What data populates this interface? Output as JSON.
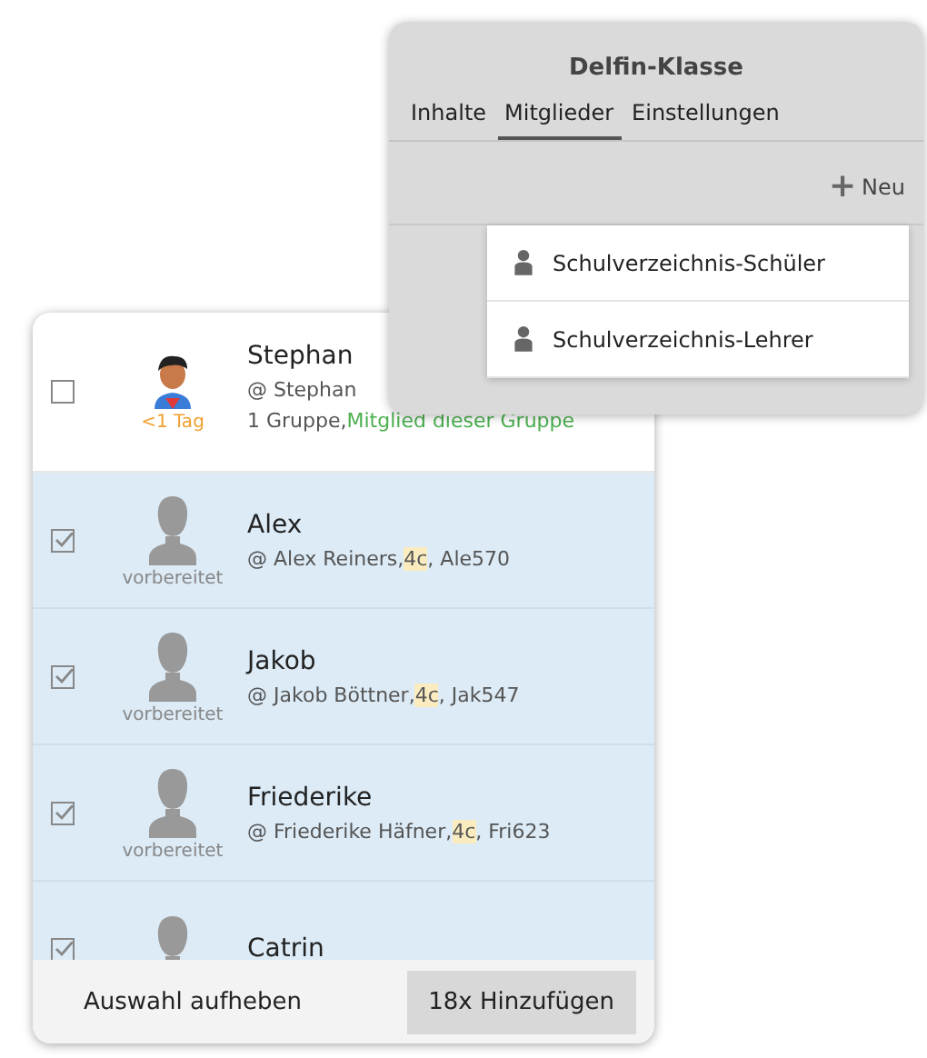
{
  "dialog": {
    "title": "Delfin-Klasse",
    "tabs": [
      {
        "label": "Inhalte",
        "selected": false
      },
      {
        "label": "Mitglieder",
        "selected": true
      },
      {
        "label": "Einstellungen",
        "selected": false
      }
    ],
    "new_button": {
      "icon": "+",
      "label": "Neu"
    },
    "menu": [
      {
        "label": "Schulverzeichnis-Schüler"
      },
      {
        "label": "Schulverzeichnis-Lehrer"
      }
    ]
  },
  "members": [
    {
      "name": "Stephan",
      "handle": "@ Stephan",
      "checked": false,
      "kind": "person",
      "status": {
        "label": "<1 Tag",
        "color": "#f0a030"
      },
      "groups": "1 Gruppe, ",
      "membership": "Mitglied dieser Gruppe"
    },
    {
      "name": "Alex",
      "handle": "@ Alex Reiners,",
      "class": "4c",
      "code": ", Ale570",
      "checked": true,
      "kind": "placeholder",
      "status": {
        "label": "vorbereitet",
        "color": "#888888"
      }
    },
    {
      "name": "Jakob",
      "handle": "@ Jakob Böttner,",
      "class": "4c",
      "code": ", Jak547",
      "checked": true,
      "kind": "placeholder",
      "status": {
        "label": "vorbereitet",
        "color": "#888888"
      }
    },
    {
      "name": "Friederike",
      "handle": "@ Friederike Häfner,",
      "class": "4c",
      "code": ", Fri623",
      "checked": true,
      "kind": "placeholder",
      "status": {
        "label": "vorbereitet",
        "color": "#888888"
      }
    },
    {
      "name": "Catrin",
      "checked": true,
      "kind": "placeholder"
    }
  ],
  "footer": {
    "clear_button": "Auswahl aufheben",
    "add_button": "18x Hinzufügen"
  }
}
